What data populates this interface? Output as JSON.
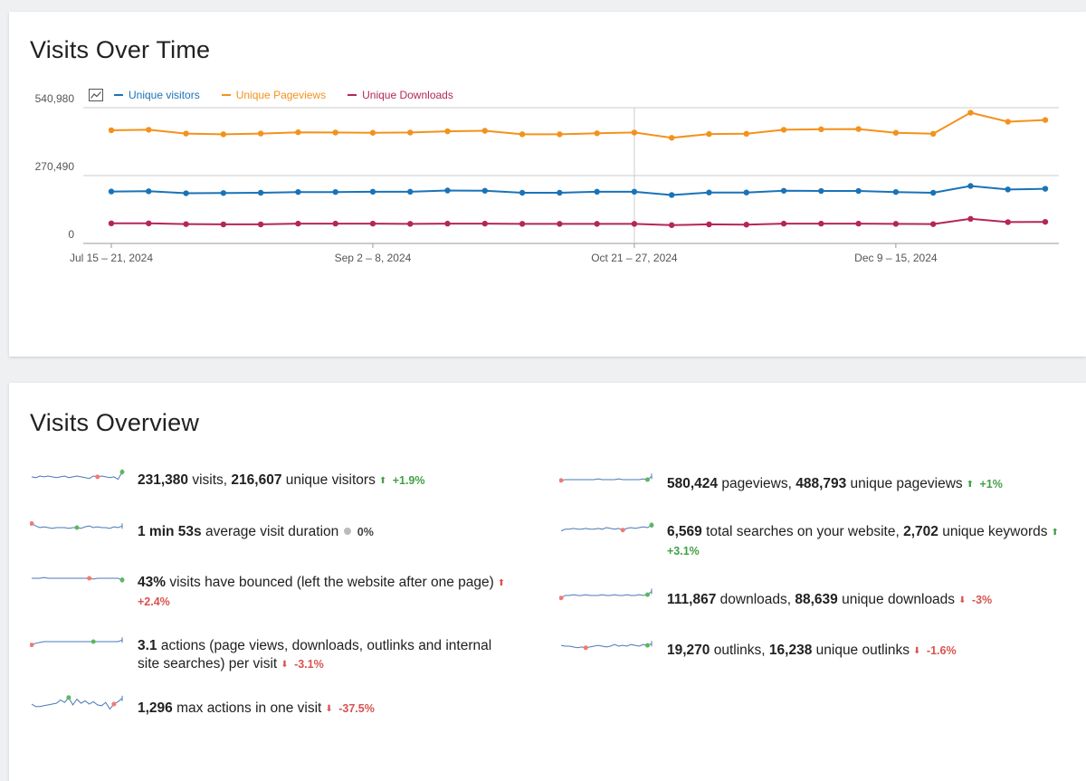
{
  "visits_over_time": {
    "title": "Visits Over Time",
    "legend": [
      {
        "label": "Unique visitors",
        "color": "#1a73b7"
      },
      {
        "label": "Unique Pageviews",
        "color": "#f3921b"
      },
      {
        "label": "Unique Downloads",
        "color": "#b4265b"
      }
    ],
    "legend_icon": "line-chart-icon"
  },
  "chart_data": {
    "type": "line",
    "title": "Visits Over Time",
    "y_ticks": [
      "540,980",
      "270,490",
      "0"
    ],
    "ylim": [
      0,
      540980
    ],
    "x_tick_labels": [
      {
        "index": 0,
        "label": "Jul 15 – 21, 2024"
      },
      {
        "index": 7,
        "label": "Sep 2 – 8, 2024"
      },
      {
        "index": 14,
        "label": "Oct 21 – 27, 2024"
      },
      {
        "index": 21,
        "label": "Dec 9 – 15, 2024"
      }
    ],
    "grid": true,
    "legend_position": "top-left",
    "series": [
      {
        "name": "Unique Pageviews",
        "color": "#f3921b",
        "values": [
          451000,
          453000,
          438000,
          435000,
          438000,
          443000,
          442000,
          441000,
          442000,
          447000,
          449000,
          435000,
          435000,
          439000,
          442000,
          421000,
          436000,
          437000,
          453000,
          455000,
          456000,
          441000,
          437000,
          521000,
          485000,
          492000
        ]
      },
      {
        "name": "Unique visitors",
        "color": "#1a73b7",
        "values": [
          207000,
          208000,
          200000,
          201000,
          202000,
          205000,
          205000,
          206000,
          206000,
          211000,
          210000,
          202000,
          202000,
          206000,
          206000,
          193000,
          203000,
          203000,
          210000,
          209000,
          209000,
          205000,
          202000,
          229000,
          215000,
          218000
        ]
      },
      {
        "name": "Unique Downloads",
        "color": "#b4265b",
        "values": [
          80000,
          80000,
          77000,
          76000,
          76000,
          79000,
          79000,
          79000,
          78000,
          79000,
          79000,
          78000,
          78000,
          78000,
          78000,
          73000,
          76000,
          75000,
          79000,
          79000,
          79000,
          78000,
          77000,
          98000,
          85000,
          86000
        ]
      }
    ]
  },
  "visits_overview": {
    "title": "Visits Overview",
    "left": [
      {
        "parts": [
          {
            "t": "231,380",
            "b": true
          },
          {
            "t": " visits, "
          },
          {
            "t": "216,607",
            "b": true
          },
          {
            "t": " unique visitors"
          }
        ],
        "trend": "+1.9%",
        "dir": "up",
        "spark": [
          0.55,
          0.6,
          0.5,
          0.55,
          0.5,
          0.55,
          0.6,
          0.55,
          0.5,
          0.6,
          0.55,
          0.5,
          0.55,
          0.6,
          0.65,
          0.5,
          0.55,
          0.5,
          0.55,
          0.6,
          0.55,
          0.7,
          0.25
        ],
        "min_idx": 16,
        "max_idx": 22
      },
      {
        "parts": [
          {
            "t": "1 min 53s",
            "b": true
          },
          {
            "t": " average visit duration"
          }
        ],
        "trend": "0%",
        "dir": "neutral",
        "spark": [
          0.25,
          0.4,
          0.5,
          0.45,
          0.5,
          0.55,
          0.5,
          0.5,
          0.5,
          0.55,
          0.5,
          0.5,
          0.55,
          0.45,
          0.4,
          0.5,
          0.45,
          0.5,
          0.5,
          0.55,
          0.45,
          0.5,
          0.4
        ],
        "min_idx": 0,
        "max_idx": 11
      },
      {
        "parts": [
          {
            "t": "43%",
            "b": true
          },
          {
            "t": " visits have bounced (left the website after one page)"
          }
        ],
        "trend": "+2.4%",
        "dir": "up-red",
        "spark": [
          0.5,
          0.5,
          0.5,
          0.45,
          0.5,
          0.5,
          0.5,
          0.5,
          0.5,
          0.5,
          0.5,
          0.5,
          0.5,
          0.5,
          0.5,
          0.55,
          0.5,
          0.5,
          0.5,
          0.5,
          0.5,
          0.5,
          0.6
        ],
        "min_idx": 14,
        "max_idx": 22
      },
      {
        "parts": [
          {
            "t": "3.1",
            "b": true
          },
          {
            "t": " actions (page views, downloads, outlinks and internal site searches) per visit"
          }
        ],
        "trend": "-3.1%",
        "dir": "down",
        "spark": [
          0.7,
          0.6,
          0.55,
          0.5,
          0.5,
          0.5,
          0.5,
          0.5,
          0.5,
          0.5,
          0.5,
          0.5,
          0.5,
          0.5,
          0.5,
          0.5,
          0.5,
          0.5,
          0.5,
          0.5,
          0.5,
          0.5,
          0.4
        ],
        "min_idx": 0,
        "max_idx": 15
      },
      {
        "parts": [
          {
            "t": "1,296",
            "b": true
          },
          {
            "t": " max actions in one visit"
          }
        ],
        "trend": "-37.5%",
        "dir": "down",
        "spark": [
          0.5,
          0.65,
          0.65,
          0.6,
          0.55,
          0.5,
          0.45,
          0.25,
          0.4,
          0.1,
          0.55,
          0.2,
          0.45,
          0.3,
          0.5,
          0.35,
          0.55,
          0.6,
          0.4,
          0.8,
          0.5,
          0.35,
          0.15
        ],
        "min_idx": 20,
        "max_idx": 9
      }
    ],
    "right": [
      {
        "parts": [
          {
            "t": "580,424",
            "b": true
          },
          {
            "t": " pageviews, "
          },
          {
            "t": "488,793",
            "b": true
          },
          {
            "t": " unique pageviews"
          }
        ],
        "trend": "+1%",
        "dir": "up",
        "spark": [
          0.55,
          0.5,
          0.5,
          0.5,
          0.5,
          0.5,
          0.5,
          0.5,
          0.5,
          0.45,
          0.5,
          0.5,
          0.5,
          0.5,
          0.45,
          0.5,
          0.5,
          0.5,
          0.5,
          0.5,
          0.45,
          0.5,
          0.3
        ],
        "min_idx": 0,
        "max_idx": 21
      },
      {
        "parts": [
          {
            "t": "6,569",
            "b": true
          },
          {
            "t": " total searches on your website, "
          },
          {
            "t": "2,702",
            "b": true
          },
          {
            "t": " unique keywords"
          }
        ],
        "trend": "+3.1%",
        "dir": "up",
        "spark": [
          0.7,
          0.6,
          0.6,
          0.55,
          0.6,
          0.6,
          0.55,
          0.6,
          0.6,
          0.55,
          0.6,
          0.5,
          0.55,
          0.6,
          0.55,
          0.65,
          0.55,
          0.5,
          0.55,
          0.5,
          0.45,
          0.5,
          0.35
        ],
        "min_idx": 15,
        "max_idx": 22
      },
      {
        "parts": [
          {
            "t": "111,867",
            "b": true
          },
          {
            "t": " downloads, "
          },
          {
            "t": "88,639",
            "b": true
          },
          {
            "t": " unique downloads"
          }
        ],
        "trend": "-3%",
        "dir": "down",
        "spark": [
          0.65,
          0.5,
          0.5,
          0.45,
          0.5,
          0.5,
          0.45,
          0.5,
          0.5,
          0.5,
          0.45,
          0.5,
          0.5,
          0.45,
          0.5,
          0.5,
          0.45,
          0.5,
          0.5,
          0.45,
          0.5,
          0.45,
          0.25
        ],
        "min_idx": 0,
        "max_idx": 21
      },
      {
        "parts": [
          {
            "t": "19,270",
            "b": true
          },
          {
            "t": " outlinks, "
          },
          {
            "t": "16,238",
            "b": true
          },
          {
            "t": " unique outlinks"
          }
        ],
        "trend": "-1.6%",
        "dir": "down",
        "spark": [
          0.45,
          0.5,
          0.5,
          0.55,
          0.6,
          0.55,
          0.6,
          0.55,
          0.5,
          0.45,
          0.5,
          0.55,
          0.5,
          0.4,
          0.5,
          0.45,
          0.5,
          0.4,
          0.45,
          0.5,
          0.4,
          0.45,
          0.35
        ],
        "min_idx": 6,
        "max_idx": 21
      }
    ]
  }
}
